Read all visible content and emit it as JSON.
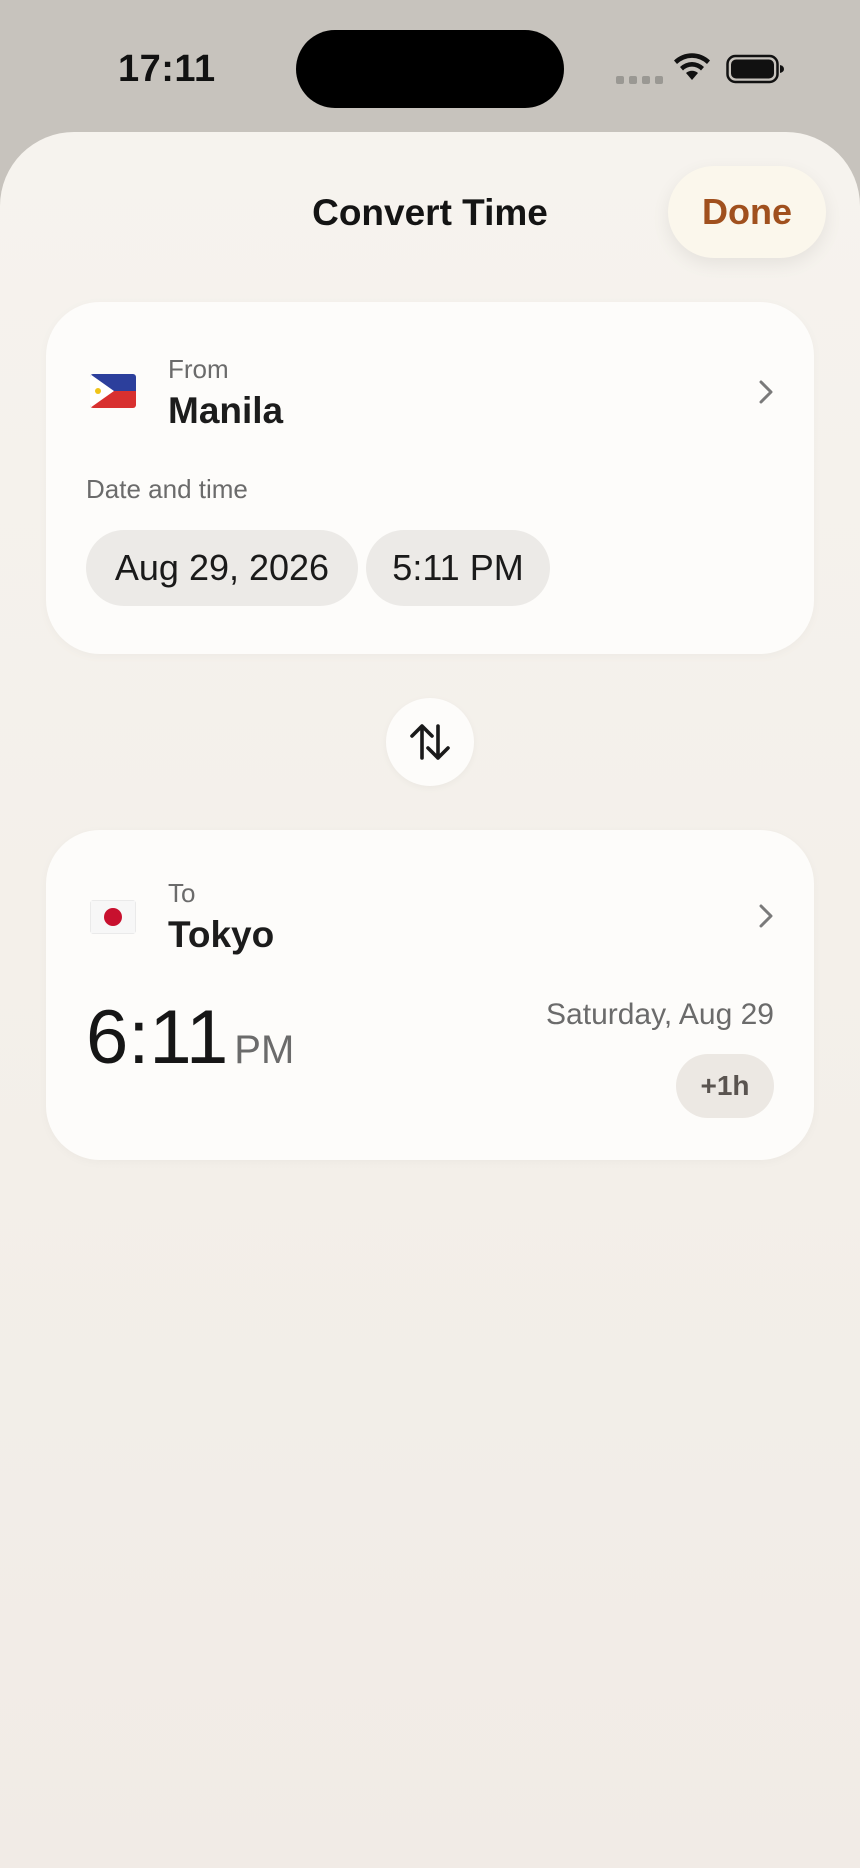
{
  "status_bar": {
    "time": "17:11",
    "icons": [
      "signal-icon",
      "wifi-icon",
      "battery-icon"
    ]
  },
  "header": {
    "title": "Convert Time",
    "done_label": "Done"
  },
  "from_card": {
    "caption": "From",
    "city": "Manila",
    "flag_icon": "philippines-flag-icon",
    "date_time_label": "Date and time",
    "date_value": "Aug 29, 2026",
    "time_value": "5:11 PM"
  },
  "swap": {
    "icon": "swap-vertical-icon"
  },
  "to_card": {
    "caption": "To",
    "city": "Tokyo",
    "flag_icon": "japan-flag-icon",
    "time_value": "6:11",
    "time_period": "PM",
    "date_text": "Saturday, Aug 29",
    "offset": "+1h"
  },
  "colors": {
    "accent": "#a0501e",
    "sheet_background": "#f4f0eb",
    "card_background": "#fdfcfa",
    "pill_background": "#eceae7"
  }
}
